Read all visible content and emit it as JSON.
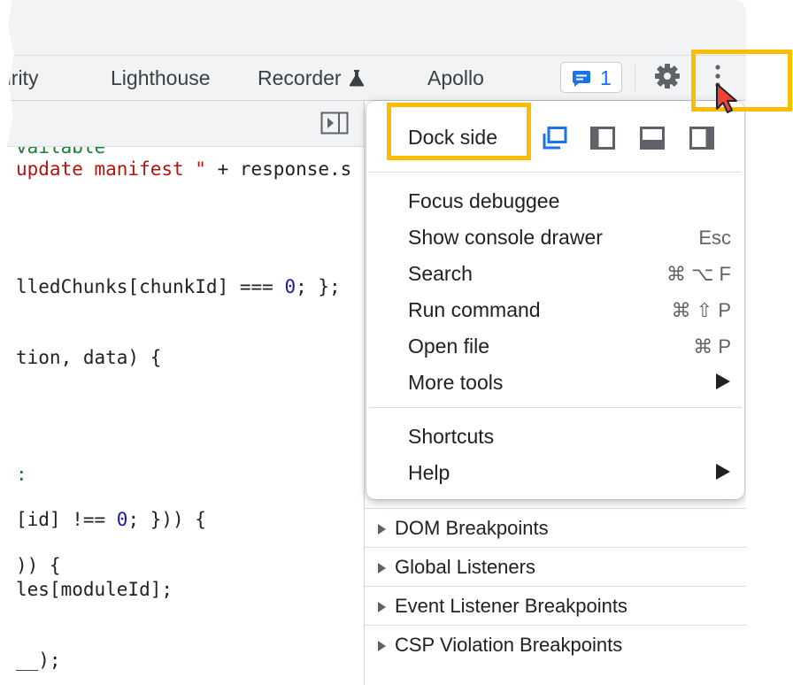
{
  "tabs": [
    {
      "label": "urity"
    },
    {
      "label": "Lighthouse"
    },
    {
      "label": "Recorder"
    },
    {
      "label": "Apollo"
    }
  ],
  "issues_badge": {
    "count": "1"
  },
  "editor": {
    "lines": [
      {
        "parts": [
          {
            "t": "vailable",
            "c": "tk-green"
          }
        ]
      },
      {
        "parts": [
          {
            "t": "update manifest \"",
            "c": "tk-str"
          },
          {
            "t": " + response.s",
            "c": ""
          }
        ]
      },
      {
        "parts": [
          {
            "t": "lledChunks[chunkId] === ",
            "c": ""
          },
          {
            "t": "0",
            "c": "tk-num"
          },
          {
            "t": "; };",
            "c": ""
          }
        ]
      },
      {
        "parts": [
          {
            "t": "tion, data) {",
            "c": ""
          }
        ]
      },
      {
        "parts": [
          {
            "t": ":",
            "c": "tk-green"
          }
        ]
      },
      {
        "parts": [
          {
            "t": "[id] !== ",
            "c": ""
          },
          {
            "t": "0",
            "c": "tk-num"
          },
          {
            "t": "; })) {",
            "c": ""
          }
        ]
      },
      {
        "parts": [
          {
            "t": ")) {",
            "c": ""
          }
        ]
      },
      {
        "parts": [
          {
            "t": "les[moduleId];",
            "c": ""
          }
        ]
      },
      {
        "parts": [
          {
            "t": "__);",
            "c": ""
          }
        ]
      }
    ]
  },
  "menu": {
    "dock_side_label": "Dock side",
    "items": [
      {
        "label": "Focus debuggee",
        "shortcut": ""
      },
      {
        "label": "Show console drawer",
        "shortcut": "Esc"
      },
      {
        "label": "Search",
        "shortcut": "⌘ ⌥ F"
      },
      {
        "label": "Run command",
        "shortcut": "⌘ ⇧ P"
      },
      {
        "label": "Open file",
        "shortcut": "⌘ P"
      },
      {
        "label": "More tools",
        "shortcut": ""
      },
      {
        "label": "Shortcuts",
        "shortcut": ""
      },
      {
        "label": "Help",
        "shortcut": ""
      }
    ]
  },
  "sidebar": {
    "sections": [
      {
        "label": "DOM Breakpoints"
      },
      {
        "label": "Global Listeners"
      },
      {
        "label": "Event Listener Breakpoints"
      },
      {
        "label": "CSP Violation Breakpoints"
      }
    ]
  },
  "colors": {
    "highlight": "#fbbc04",
    "accent_blue": "#1a73e8",
    "cursor_red": "#ea4335"
  }
}
